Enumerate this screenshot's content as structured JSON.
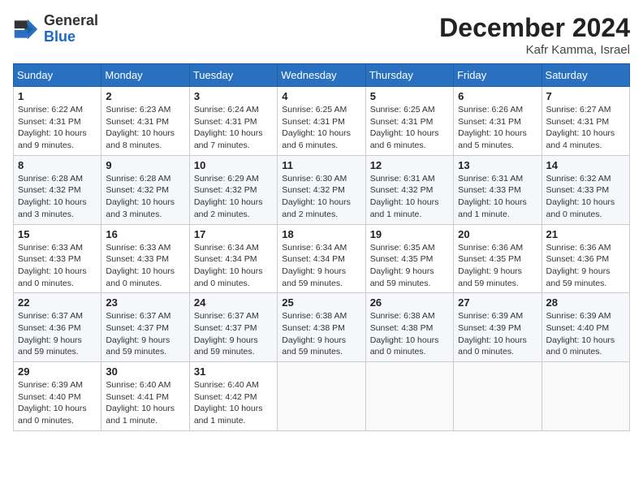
{
  "header": {
    "logo_general": "General",
    "logo_blue": "Blue",
    "month_title": "December 2024",
    "location": "Kafr Kamma, Israel"
  },
  "days_of_week": [
    "Sunday",
    "Monday",
    "Tuesday",
    "Wednesday",
    "Thursday",
    "Friday",
    "Saturday"
  ],
  "weeks": [
    [
      {
        "day": "1",
        "sunrise": "6:22 AM",
        "sunset": "4:31 PM",
        "daylight": "10 hours and 9 minutes."
      },
      {
        "day": "2",
        "sunrise": "6:23 AM",
        "sunset": "4:31 PM",
        "daylight": "10 hours and 8 minutes."
      },
      {
        "day": "3",
        "sunrise": "6:24 AM",
        "sunset": "4:31 PM",
        "daylight": "10 hours and 7 minutes."
      },
      {
        "day": "4",
        "sunrise": "6:25 AM",
        "sunset": "4:31 PM",
        "daylight": "10 hours and 6 minutes."
      },
      {
        "day": "5",
        "sunrise": "6:25 AM",
        "sunset": "4:31 PM",
        "daylight": "10 hours and 6 minutes."
      },
      {
        "day": "6",
        "sunrise": "6:26 AM",
        "sunset": "4:31 PM",
        "daylight": "10 hours and 5 minutes."
      },
      {
        "day": "7",
        "sunrise": "6:27 AM",
        "sunset": "4:31 PM",
        "daylight": "10 hours and 4 minutes."
      }
    ],
    [
      {
        "day": "8",
        "sunrise": "6:28 AM",
        "sunset": "4:32 PM",
        "daylight": "10 hours and 3 minutes."
      },
      {
        "day": "9",
        "sunrise": "6:28 AM",
        "sunset": "4:32 PM",
        "daylight": "10 hours and 3 minutes."
      },
      {
        "day": "10",
        "sunrise": "6:29 AM",
        "sunset": "4:32 PM",
        "daylight": "10 hours and 2 minutes."
      },
      {
        "day": "11",
        "sunrise": "6:30 AM",
        "sunset": "4:32 PM",
        "daylight": "10 hours and 2 minutes."
      },
      {
        "day": "12",
        "sunrise": "6:31 AM",
        "sunset": "4:32 PM",
        "daylight": "10 hours and 1 minute."
      },
      {
        "day": "13",
        "sunrise": "6:31 AM",
        "sunset": "4:33 PM",
        "daylight": "10 hours and 1 minute."
      },
      {
        "day": "14",
        "sunrise": "6:32 AM",
        "sunset": "4:33 PM",
        "daylight": "10 hours and 0 minutes."
      }
    ],
    [
      {
        "day": "15",
        "sunrise": "6:33 AM",
        "sunset": "4:33 PM",
        "daylight": "10 hours and 0 minutes."
      },
      {
        "day": "16",
        "sunrise": "6:33 AM",
        "sunset": "4:33 PM",
        "daylight": "10 hours and 0 minutes."
      },
      {
        "day": "17",
        "sunrise": "6:34 AM",
        "sunset": "4:34 PM",
        "daylight": "10 hours and 0 minutes."
      },
      {
        "day": "18",
        "sunrise": "6:34 AM",
        "sunset": "4:34 PM",
        "daylight": "9 hours and 59 minutes."
      },
      {
        "day": "19",
        "sunrise": "6:35 AM",
        "sunset": "4:35 PM",
        "daylight": "9 hours and 59 minutes."
      },
      {
        "day": "20",
        "sunrise": "6:36 AM",
        "sunset": "4:35 PM",
        "daylight": "9 hours and 59 minutes."
      },
      {
        "day": "21",
        "sunrise": "6:36 AM",
        "sunset": "4:36 PM",
        "daylight": "9 hours and 59 minutes."
      }
    ],
    [
      {
        "day": "22",
        "sunrise": "6:37 AM",
        "sunset": "4:36 PM",
        "daylight": "9 hours and 59 minutes."
      },
      {
        "day": "23",
        "sunrise": "6:37 AM",
        "sunset": "4:37 PM",
        "daylight": "9 hours and 59 minutes."
      },
      {
        "day": "24",
        "sunrise": "6:37 AM",
        "sunset": "4:37 PM",
        "daylight": "9 hours and 59 minutes."
      },
      {
        "day": "25",
        "sunrise": "6:38 AM",
        "sunset": "4:38 PM",
        "daylight": "9 hours and 59 minutes."
      },
      {
        "day": "26",
        "sunrise": "6:38 AM",
        "sunset": "4:38 PM",
        "daylight": "10 hours and 0 minutes."
      },
      {
        "day": "27",
        "sunrise": "6:39 AM",
        "sunset": "4:39 PM",
        "daylight": "10 hours and 0 minutes."
      },
      {
        "day": "28",
        "sunrise": "6:39 AM",
        "sunset": "4:40 PM",
        "daylight": "10 hours and 0 minutes."
      }
    ],
    [
      {
        "day": "29",
        "sunrise": "6:39 AM",
        "sunset": "4:40 PM",
        "daylight": "10 hours and 0 minutes."
      },
      {
        "day": "30",
        "sunrise": "6:40 AM",
        "sunset": "4:41 PM",
        "daylight": "10 hours and 1 minute."
      },
      {
        "day": "31",
        "sunrise": "6:40 AM",
        "sunset": "4:42 PM",
        "daylight": "10 hours and 1 minute."
      },
      null,
      null,
      null,
      null
    ]
  ]
}
